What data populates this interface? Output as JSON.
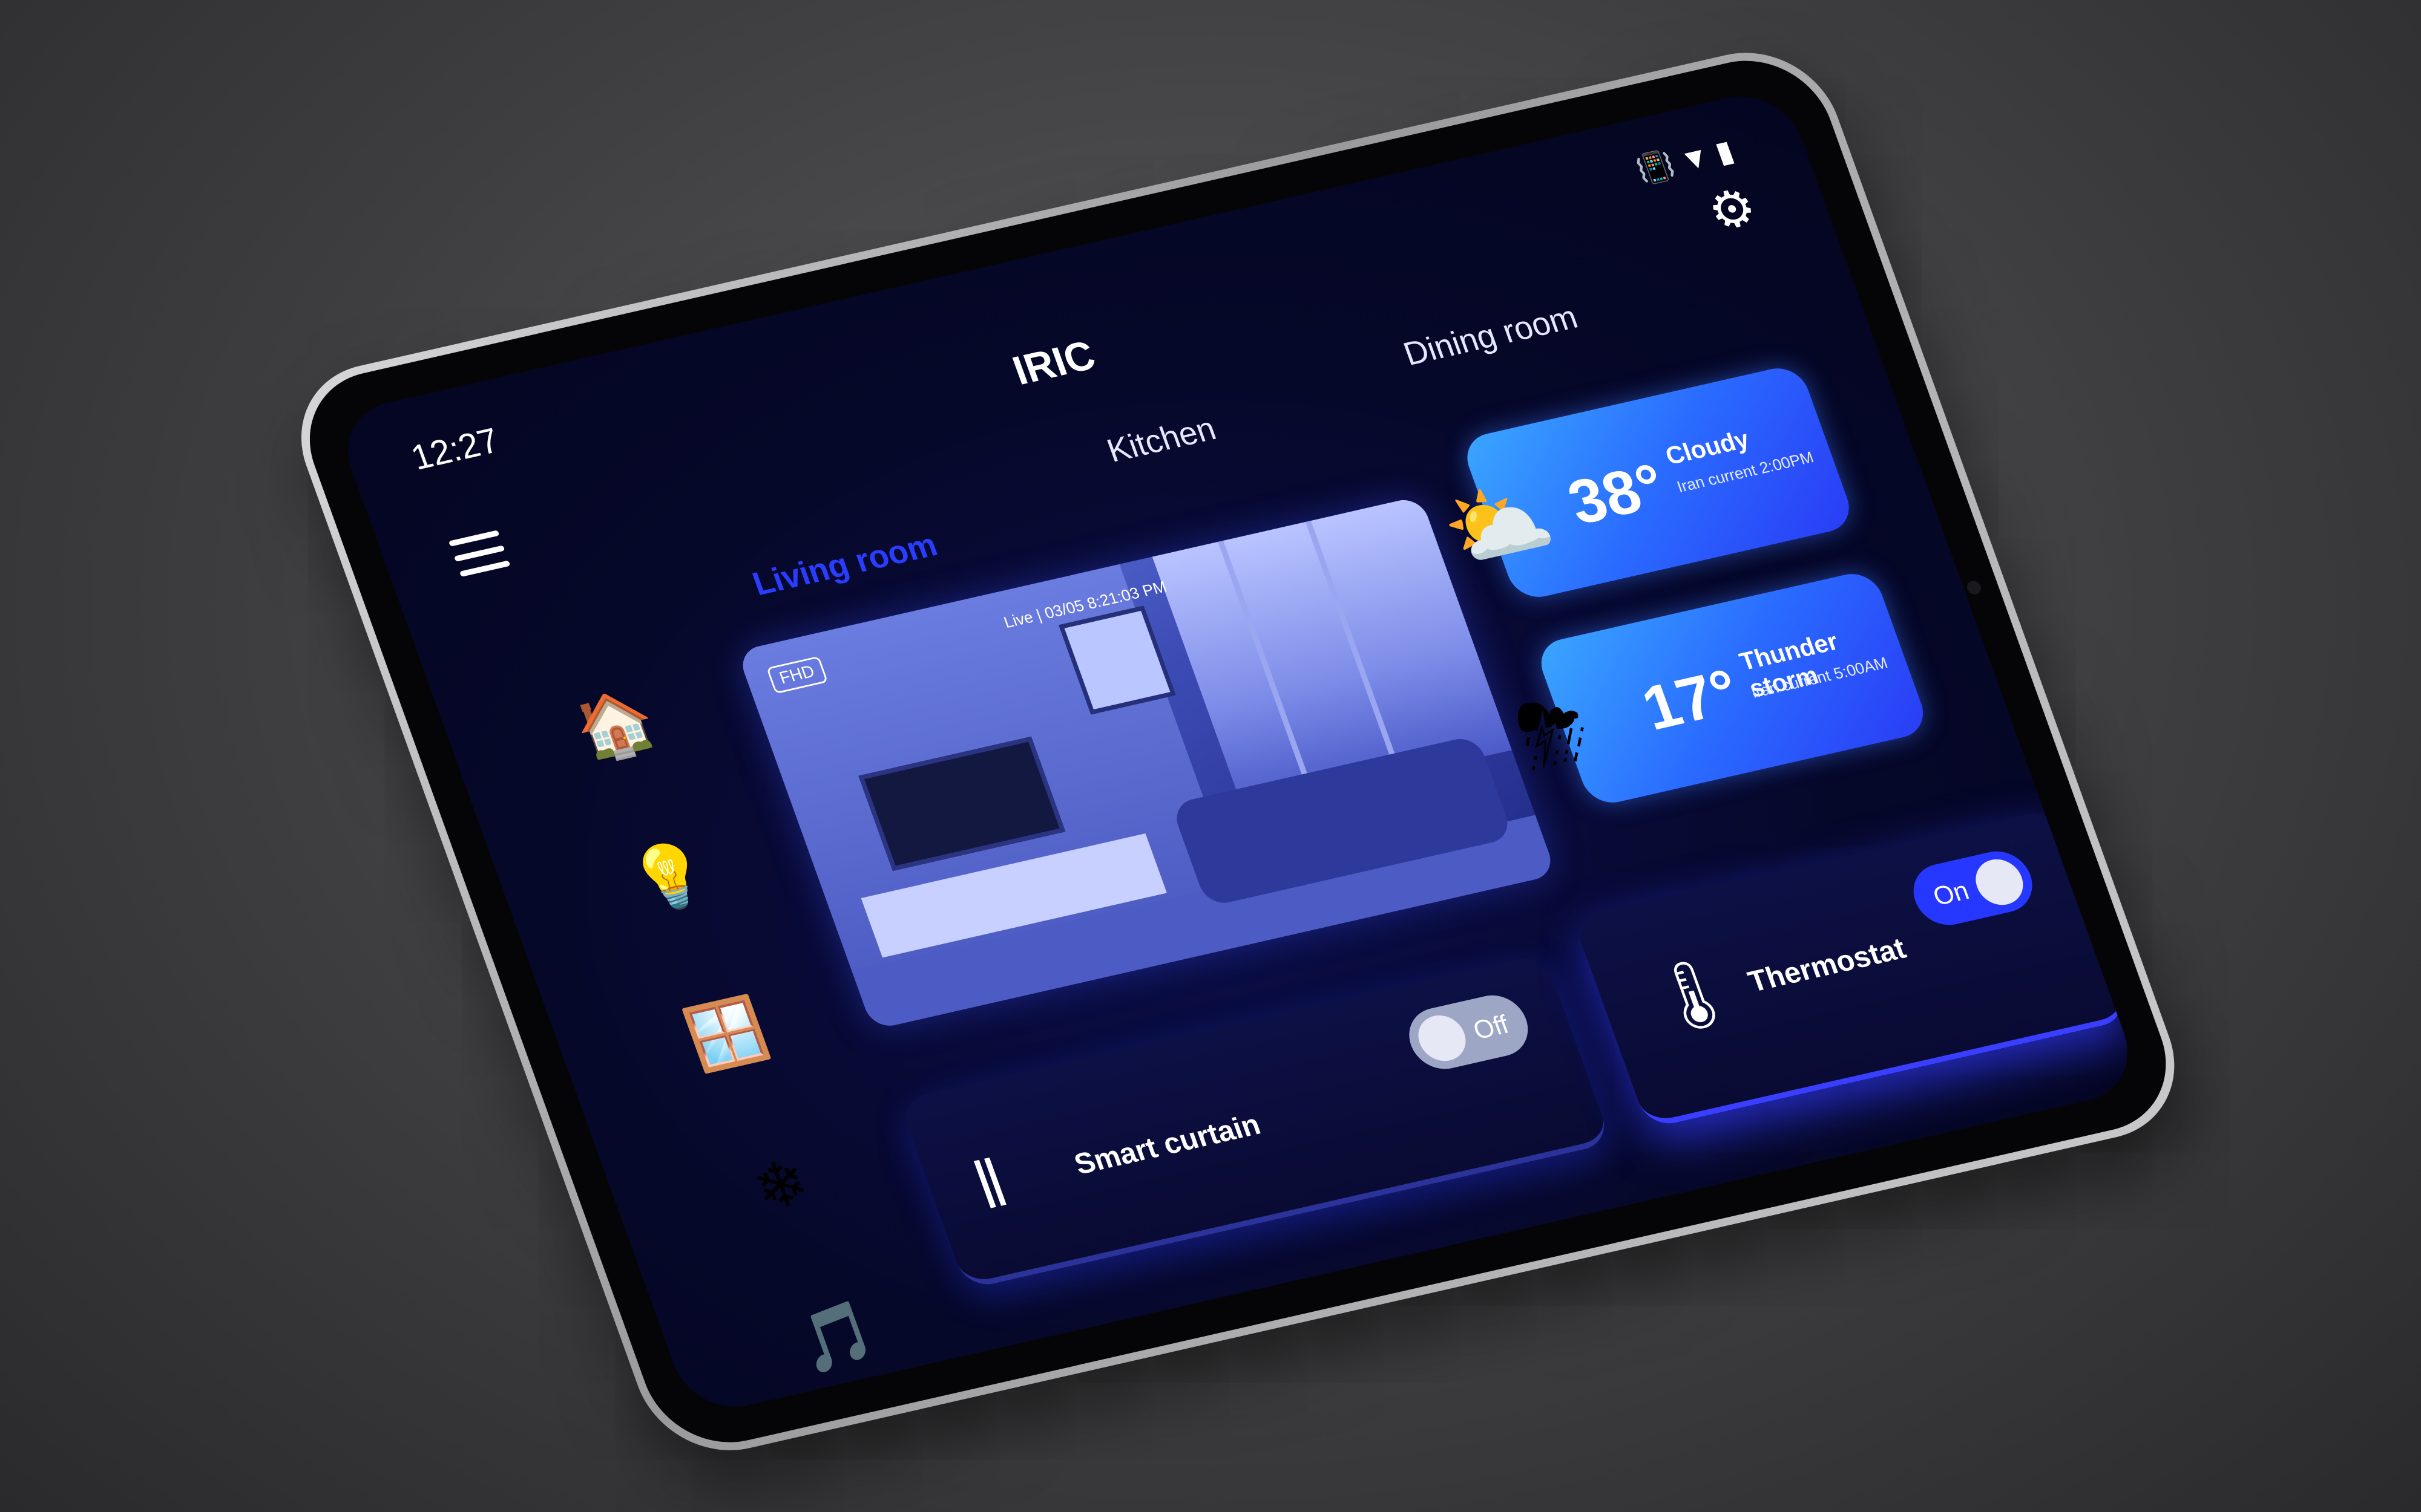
{
  "status_bar": {
    "time": "12:27",
    "icons": [
      "vibrate-icon",
      "wifi-icon",
      "battery-icon"
    ]
  },
  "header": {
    "title": "IRIC",
    "settings_icon": "gear-icon",
    "menu_icon": "hamburger-icon"
  },
  "tabs": [
    {
      "label": "Living room",
      "active": true
    },
    {
      "label": "Kitchen",
      "active": false
    },
    {
      "label": "Dining room",
      "active": false
    }
  ],
  "sidebar": [
    {
      "icon": "house-icon"
    },
    {
      "icon": "lightbulb-icon"
    },
    {
      "icon": "window-curtain-icon"
    },
    {
      "icon": "air-conditioner-icon"
    },
    {
      "icon": "music-icon"
    }
  ],
  "camera": {
    "quality_label": "FHD",
    "live_label": "Live | 03/05 8:21:03 PM"
  },
  "weather": [
    {
      "temp": "38°",
      "condition": "Cloudy",
      "subtitle": "Iran current 2:00PM",
      "icon": "partly-cloudy-sun-icon"
    },
    {
      "temp": "17°",
      "condition": "Thunder storm",
      "subtitle": "Iran current 5:00AM",
      "icon": "thunderstorm-cloud-icon"
    }
  ],
  "devices": {
    "curtain": {
      "label": "Smart curtain",
      "toggle_label": "Off",
      "on": false,
      "icon": "curtain-icon"
    },
    "thermostat": {
      "label": "Thermostat",
      "toggle_label": "On",
      "on": true,
      "icon": "thermostat-icon"
    }
  },
  "colors": {
    "accent": "#2638ff",
    "active_tab": "#2a3dff",
    "background": "#06082a",
    "card_gradient_start": "#3aa6ff"
  }
}
